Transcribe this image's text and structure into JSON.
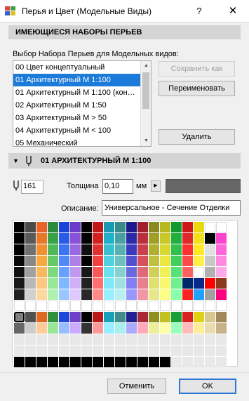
{
  "window": {
    "title": "Перья и Цвет (Модельные Виды)",
    "help_label": "?",
    "close_label": "✕",
    "app_icon": "pen-color-app-icon",
    "help_icon": "question-icon",
    "close_icon": "close-icon"
  },
  "sets": {
    "header": "ИМЕЮЩИЕСЯ НАБОРЫ ПЕРЬЕВ",
    "list_label": "Выбор Набора Перьев для Модельных видов:",
    "items": [
      "00 Цвет концептуальный",
      "01 Архитектурный М 1:100",
      "01 Архитектурный М 1:100 (кон…",
      "02 Архитектурный М 1:50",
      "03 Архитектурный М > 50",
      "04 Архитектурный М < 100",
      "05 Механический"
    ],
    "selected_index": 1,
    "save_as_label": "Сохранить как",
    "rename_label": "Переименовать",
    "delete_label": "Удалить"
  },
  "pen": {
    "header_name": "01 АРХИТЕКТУРНЫЙ М 1:100",
    "number": "161",
    "thickness_label": "Толщина",
    "thickness_value": "0,10",
    "unit": "мм",
    "color": "#666666",
    "description_label": "Описание:",
    "description_value": "Универсальное - Сечение Отделки"
  },
  "palette": {
    "rows": [
      [
        "#000000",
        "#4a4a4a",
        "#e8622a",
        "#2c8a3c",
        "#1a44d8",
        "#6a3cc8",
        "#000000",
        "#c01818",
        "#1a9ab0",
        "#3a8a8a",
        "#1a1a8a",
        "#a02030",
        "#8a8a20",
        "#b8b820",
        "#109a30",
        "#d01818",
        "#e8d810",
        "#ffffff",
        "#ffffff"
      ],
      [
        "#000000",
        "#5a5a5a",
        "#e8782a",
        "#3aa048",
        "#2a5ae8",
        "#8a50d8",
        "#000000",
        "#d02020",
        "#20b0c8",
        "#4aa0a0",
        "#2a2aa8",
        "#b83040",
        "#a0a028",
        "#c8c828",
        "#20b040",
        "#e02828",
        "#f0e020",
        "#000000",
        "#ff44cc"
      ],
      [
        "#000000",
        "#707070",
        "#f09030",
        "#50b858",
        "#3a74f0",
        "#9a68e0",
        "#101010",
        "#e03030",
        "#38c0d0",
        "#58b0b0",
        "#3a3ac0",
        "#c84050",
        "#b0b030",
        "#d8d830",
        "#30c050",
        "#ff3030",
        "#ffe828",
        "#e0e0e0",
        "#ff66d8"
      ],
      [
        "#080808",
        "#888888",
        "#f8a840",
        "#68c868",
        "#5088f8",
        "#b080e8",
        "#000000",
        "#f04040",
        "#50d0e0",
        "#70c0c0",
        "#5050d0",
        "#d85060",
        "#c0c040",
        "#e8e840",
        "#40d060",
        "#ff4848",
        "#fff048",
        "#c8c8c8",
        "#ff88e0"
      ],
      [
        "#101010",
        "#a0a0a0",
        "#f8b860",
        "#80d880",
        "#68a0ff",
        "#c098f0",
        "#181818",
        "#f85858",
        "#68e0f0",
        "#88d0d0",
        "#6868e0",
        "#e06878",
        "#d0d058",
        "#f0f058",
        "#58e078",
        "#ff6060",
        "#ffffff",
        "#b0b0b0",
        "#ffaae8"
      ],
      [
        "#181818",
        "#b8b8b8",
        "#ffc880",
        "#98e898",
        "#80b8ff",
        "#d0b0f8",
        "#202020",
        "#ff7070",
        "#80e8f8",
        "#a0e0e0",
        "#8080f0",
        "#e88090",
        "#e0e070",
        "#f8f870",
        "#70f090",
        "#002868",
        "#0a2a8a",
        "#ff0000",
        "#8a3a1a"
      ],
      [
        "#202020",
        "#d0d0d0",
        "#ffd8a0",
        "#b0f0b0",
        "#98c8ff",
        "#e0c8ff",
        "#282828",
        "#ff8888",
        "#98f0ff",
        "#b8f0f0",
        "#9898ff",
        "#f098a8",
        "#e8e888",
        "#ffff88",
        "#88ffa8",
        "#ff2020",
        "#20a0ff",
        "#a0a0a0",
        "#ff0080"
      ],
      [
        "#ffffff",
        "#ffffff",
        "#ffffff",
        "#ffffff",
        "#ffffff",
        "#ffffff",
        "#ffffff",
        "#ffffff",
        "#ffffff",
        "#ffffff",
        "#ffffff",
        "#ffffff",
        "#ffffff",
        "#ffffff",
        "#ffffff",
        "#ffffff",
        "#ffffff",
        "#ffffff",
        "#ffffff"
      ],
      [
        "#000000",
        "#505050",
        "#e06820",
        "#30903c",
        "#2048d8",
        "#7040c8",
        "#000000",
        "#b81818",
        "#18a0b8",
        "#408c8c",
        "#202090",
        "#a82838",
        "#909020",
        "#c0c020",
        "#18a038",
        "#d82020",
        "#e0d018",
        "#d8c890",
        "#a08858"
      ],
      [
        "#666666",
        "#cccccc",
        "#ffcc99",
        "#99e699",
        "#99bbff",
        "#ccaaff",
        "#333333",
        "#ff9999",
        "#99eeff",
        "#aaeeee",
        "#aaaaff",
        "#ffaabb",
        "#eeee99",
        "#ffffaa",
        "#99ffbb",
        "#ffbbbb",
        "#ffee99",
        "#e8dcb0",
        "#c8b088"
      ],
      [
        "#e8e8e8",
        "#e8e8e8",
        "#e8e8e8",
        "#e8e8e8",
        "#e8e8e8",
        "#e8e8e8",
        "#e8e8e8",
        "#e8e8e8",
        "#e8e8e8",
        "#e8e8e8",
        "#e8e8e8",
        "#e8e8e8",
        "#e8e8e8",
        "#e8e8e8",
        "#e8e8e8",
        "#e8e8e8",
        "#e8e8e8",
        "#e8e8e8",
        "#e8e8e8"
      ],
      [
        "#e8e8e8",
        "#e8e8e8",
        "#e8e8e8",
        "#e8e8e8",
        "#e8e8e8",
        "#e8e8e8",
        "#e8e8e8",
        "#e8e8e8",
        "#e8e8e8",
        "#e8e8e8",
        "#e8e8e8",
        "#e8e8e8",
        "#e8e8e8",
        "#e8e8e8",
        "#e8e8e8",
        "#e8e8e8",
        "#e8e8e8",
        "#e8e8e8",
        "#e8e8e8"
      ],
      [
        "#000000",
        "#000000",
        "#000000",
        "#000000",
        "#000000",
        "#000000",
        "#000000",
        "#000000",
        "#000000",
        "#000000",
        "#000000",
        "#000000",
        "#000000",
        "#000000",
        "#e8e8e8",
        "#e8e8e8",
        "#e8e8e8",
        "#e8e8e8",
        "#e8e8e8"
      ]
    ],
    "selected_row": 8,
    "selected_col": 0
  },
  "footer": {
    "cancel_label": "Отменить",
    "ok_label": "OK"
  }
}
